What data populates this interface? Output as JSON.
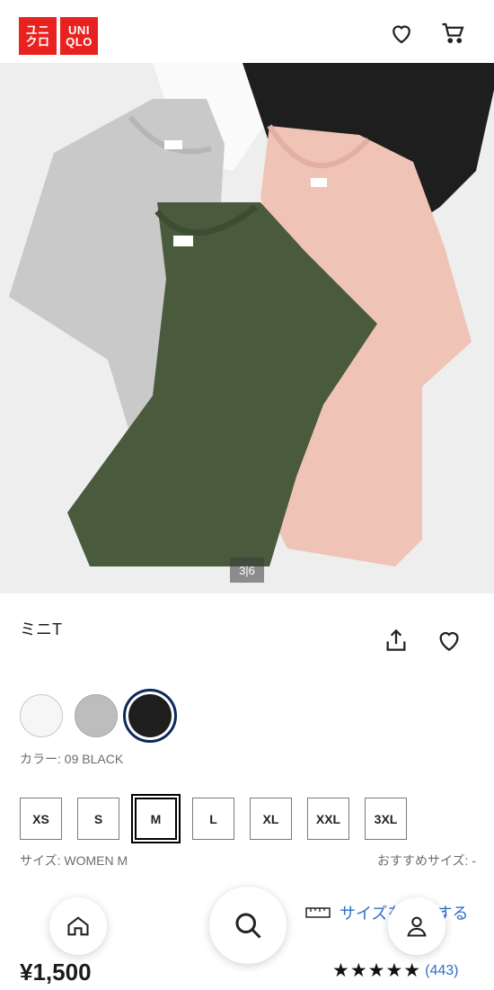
{
  "header": {
    "logo_line1": "ユニ",
    "logo_line2": "クロ",
    "logo_line3": "UNI",
    "logo_line4": "QLO",
    "logo_color": "#e8221f"
  },
  "hero": {
    "counter": "3|6",
    "colors": [
      "#ffffff",
      "#1c1c1c",
      "#c8c8c8",
      "#efc3b5",
      "#4a5b3d"
    ]
  },
  "product": {
    "title": "ミニT",
    "color_label": "カラー: 09 BLACK",
    "swatches": [
      {
        "name": "white",
        "hex": "#f6f6f6"
      },
      {
        "name": "gray",
        "hex": "#bdbdbd"
      },
      {
        "name": "black",
        "hex": "#1e1e1e",
        "selected": true
      }
    ],
    "sizes": [
      "XS",
      "S",
      "M",
      "L",
      "XL",
      "XXL",
      "3XL"
    ],
    "selected_size": "M",
    "size_label": "サイズ: WOMEN M",
    "recommended_size": "おすすめサイズ: -",
    "size_guide": "サイズを確認する",
    "price": "¥1,500",
    "rating_stars": "★★★★★",
    "rating_value": 4.5,
    "review_count": "(443)"
  },
  "icons": [
    "heart-icon",
    "cart-icon",
    "share-icon",
    "ruler-icon",
    "home-icon",
    "search-icon",
    "user-icon"
  ],
  "accent_color": "#2e6dc7"
}
